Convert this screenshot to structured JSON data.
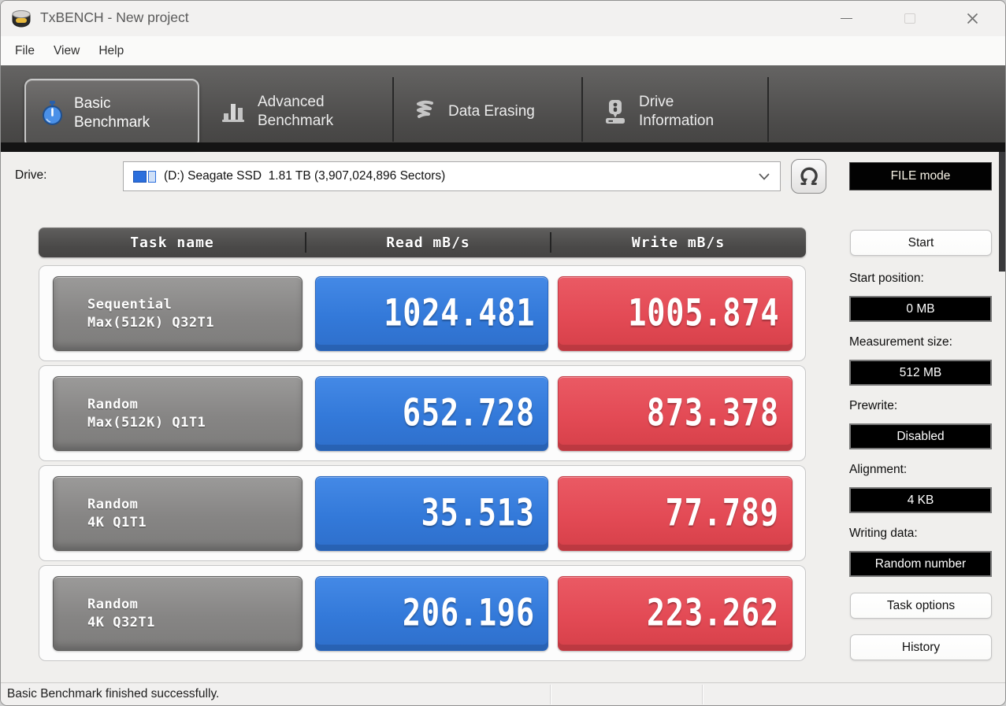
{
  "window": {
    "title": "TxBENCH - New project"
  },
  "menu": {
    "file": "File",
    "view": "View",
    "help": "Help"
  },
  "tabs": {
    "basic": {
      "line1": "Basic",
      "line2": "Benchmark",
      "selected": true
    },
    "advanced": {
      "line1": "Advanced",
      "line2": "Benchmark",
      "selected": false
    },
    "erasing": {
      "line1": "Data Erasing",
      "selected": false
    },
    "driveinfo": {
      "line1": "Drive",
      "line2": "Information",
      "selected": false
    }
  },
  "drive": {
    "label": "Drive:",
    "selected": "(D:) Seagate SSD  1.81 TB (3,907,024,896 Sectors)",
    "file_mode": "FILE mode"
  },
  "table": {
    "headers": {
      "task": "Task name",
      "read": "Read mB/s",
      "write": "Write mB/s"
    },
    "rows": [
      {
        "name1": "Sequential",
        "name2": "Max(512K) Q32T1",
        "read": "1024.481",
        "write": "1005.874"
      },
      {
        "name1": "Random",
        "name2": "Max(512K) Q1T1",
        "read": "652.728",
        "write": "873.378"
      },
      {
        "name1": "Random",
        "name2": "4K Q1T1",
        "read": "35.513",
        "write": "77.789"
      },
      {
        "name1": "Random",
        "name2": "4K Q32T1",
        "read": "206.196",
        "write": "223.262"
      }
    ]
  },
  "sidebar": {
    "start": "Start",
    "fields": [
      {
        "label": "Start position:",
        "value": "0 MB"
      },
      {
        "label": "Measurement size:",
        "value": "512 MB"
      },
      {
        "label": "Prewrite:",
        "value": "Disabled"
      },
      {
        "label": "Alignment:",
        "value": "4 KB"
      },
      {
        "label": "Writing data:",
        "value": "Random number"
      }
    ],
    "task_options": "Task options",
    "history": "History"
  },
  "statusbar": {
    "message": "Basic Benchmark finished successfully."
  },
  "colors": {
    "read_blue": "#3a82df",
    "write_red": "#e5515c",
    "stopwatch_blue": "#4a90e8",
    "field_bg": "#000000"
  }
}
